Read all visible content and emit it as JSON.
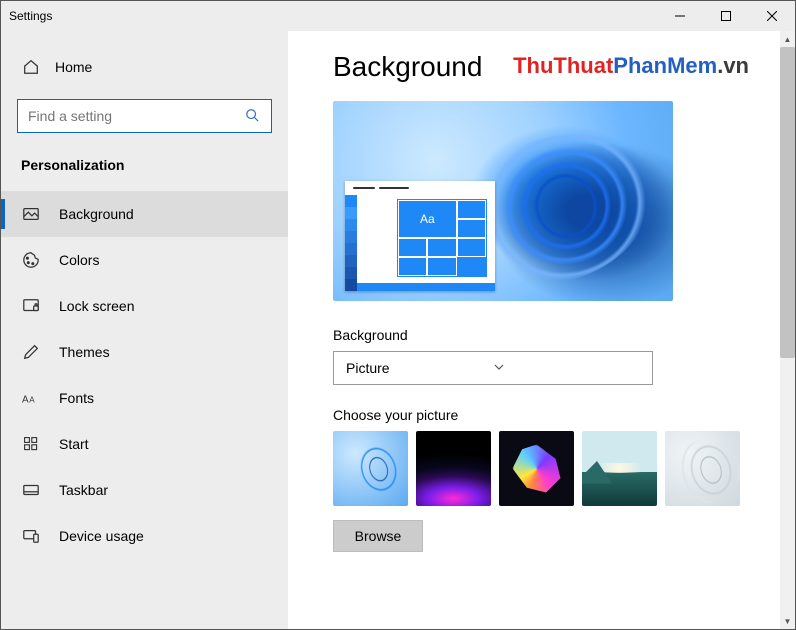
{
  "window": {
    "title": "Settings"
  },
  "watermark": {
    "part1": "ThuThuat",
    "part2": "PhanMem",
    "part3": ".vn"
  },
  "sidebar": {
    "home_label": "Home",
    "search_placeholder": "Find a setting",
    "category": "Personalization",
    "items": [
      {
        "label": "Background",
        "icon": "picture-icon",
        "active": true
      },
      {
        "label": "Colors",
        "icon": "palette-icon",
        "active": false
      },
      {
        "label": "Lock screen",
        "icon": "lock-screen-icon",
        "active": false
      },
      {
        "label": "Themes",
        "icon": "pencil-icon",
        "active": false
      },
      {
        "label": "Fonts",
        "icon": "fonts-icon",
        "active": false
      },
      {
        "label": "Start",
        "icon": "start-icon",
        "active": false
      },
      {
        "label": "Taskbar",
        "icon": "taskbar-icon",
        "active": false
      },
      {
        "label": "Device usage",
        "icon": "device-usage-icon",
        "active": false
      }
    ]
  },
  "main": {
    "title": "Background",
    "preview_sample_text": "Aa",
    "field_label": "Background",
    "dropdown_value": "Picture",
    "choose_label": "Choose your picture",
    "thumbnails": [
      "bloom-blue",
      "glow-purple",
      "abstract-flower",
      "lake-sunset",
      "bloom-gray"
    ],
    "browse_label": "Browse"
  }
}
